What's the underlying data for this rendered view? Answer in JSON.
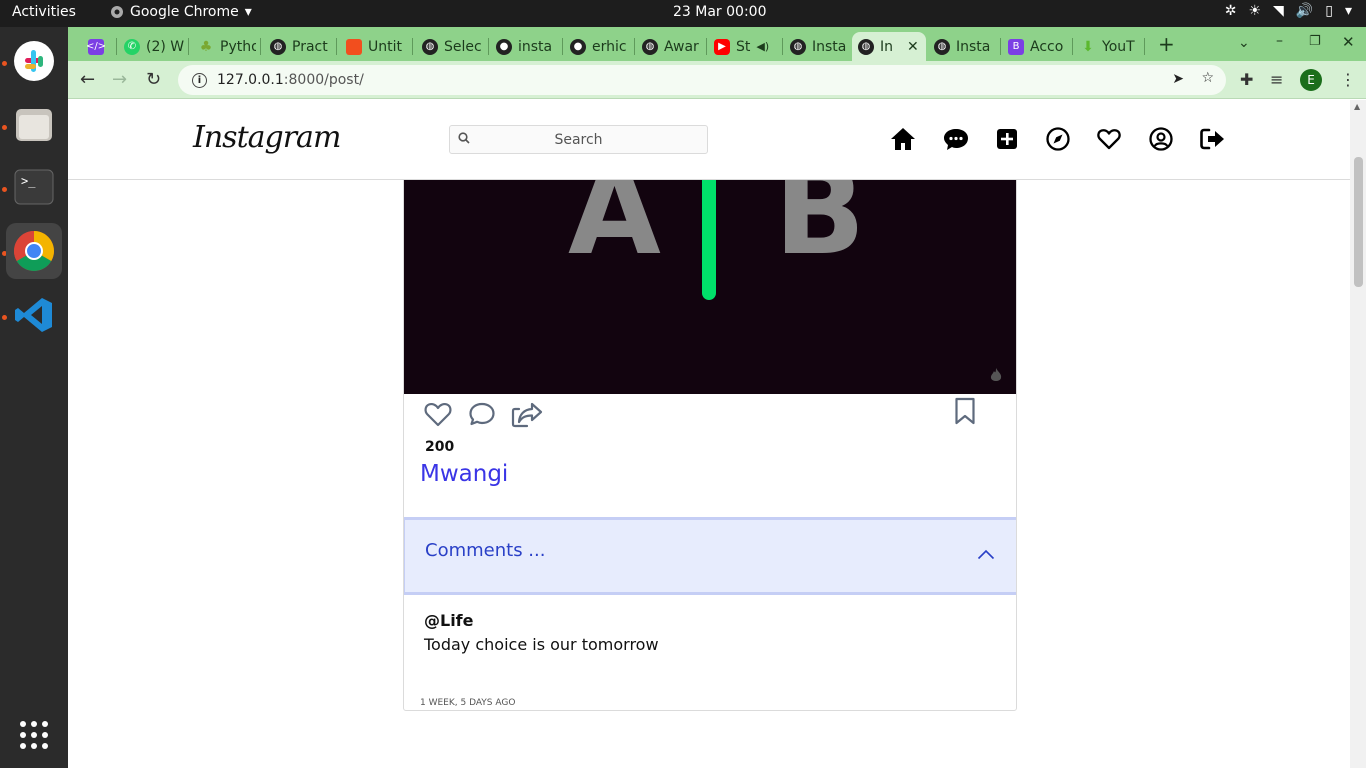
{
  "topbar": {
    "activities": "Activities",
    "app_name": "Google Chrome",
    "clock": "23 Mar  00:00"
  },
  "tabs": [
    {
      "label": "",
      "icon": "code-icon",
      "color": "#7b3fe4"
    },
    {
      "label": "(2) W",
      "icon": "whatsapp-icon",
      "color": "#25d366"
    },
    {
      "label": "Pytho",
      "icon": "tree-icon",
      "color": "#7aa832"
    },
    {
      "label": "Pract",
      "icon": "globe-icon",
      "color": "#222222"
    },
    {
      "label": "Untit",
      "icon": "figma-icon",
      "color": "#f24e1e"
    },
    {
      "label": "Selec",
      "icon": "globe-icon",
      "color": "#222222"
    },
    {
      "label": "insta",
      "icon": "github-icon",
      "color": "#222222"
    },
    {
      "label": "erhic",
      "icon": "github-icon",
      "color": "#222222"
    },
    {
      "label": "Awar",
      "icon": "globe-icon",
      "color": "#222222"
    },
    {
      "label": "St",
      "icon": "youtube-icon",
      "color": "#ff0000"
    },
    {
      "label": "Insta",
      "icon": "globe-icon",
      "color": "#222222"
    },
    {
      "label": "In",
      "icon": "globe-icon",
      "color": "#222222",
      "active": true
    },
    {
      "label": "Insta",
      "icon": "globe-icon",
      "color": "#222222"
    },
    {
      "label": "Acco",
      "icon": "bootstrap-icon",
      "color": "#7b3fe4"
    },
    {
      "label": "YouT",
      "icon": "download-icon",
      "color": "#5cb82f"
    }
  ],
  "toolbar": {
    "url_host": "127.0.0.1",
    "url_rest": ":8000/post/",
    "profile_initial": "E"
  },
  "instagram": {
    "logo": "Instagram",
    "search_placeholder": "Search",
    "nav_icons": [
      "home-icon",
      "messages-icon",
      "new-post-icon",
      "explore-icon",
      "activity-heart-icon",
      "profile-icon",
      "logout-icon"
    ]
  },
  "post": {
    "image_letters": {
      "left": "A",
      "right": "B"
    },
    "likes": "200",
    "author": "Mwangi",
    "comments_heading": "Comments ...",
    "comment": {
      "user": "@Life",
      "text": "Today choice is our tomorrow"
    },
    "time_ago": "1 WEEK, 5 DAYS AGO"
  },
  "colors": {
    "tabstrip": "#8ed28a",
    "toolbar": "#d6f0d3",
    "author_link": "#3a35e6",
    "accordion_bg": "#e7ecfd",
    "accordion_text": "#2a40c7"
  }
}
